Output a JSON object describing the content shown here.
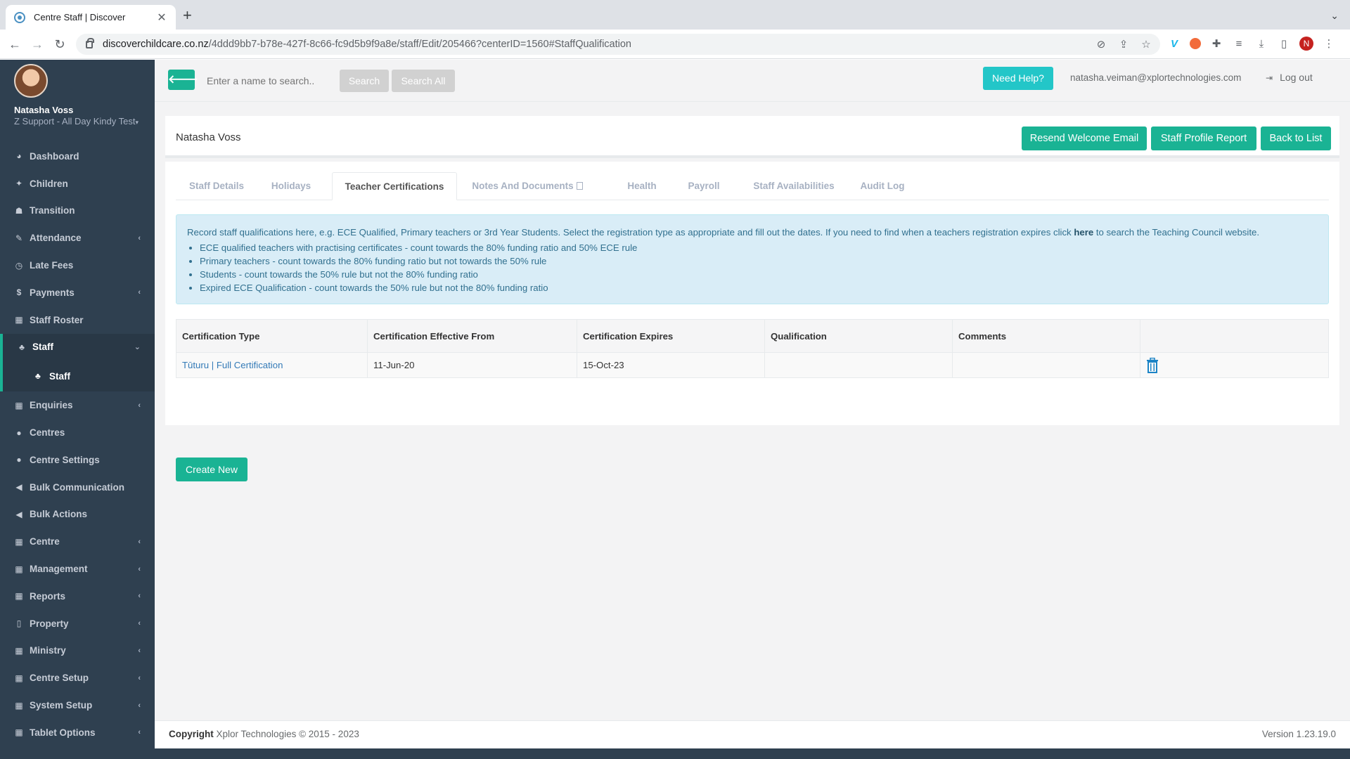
{
  "browser": {
    "tab_title": "Centre Staff | Discover",
    "tab_close": "✕",
    "new_tab": "+",
    "url_host": "discoverchildcare.co.nz",
    "url_path": "/4ddd9bb7-b78e-427f-8c66-fc9d5b9f9a8e/staff/Edit/205466?centerID=1560#StaffQualification",
    "profile_initial": "N"
  },
  "sidebar": {
    "user_name": "Natasha Voss",
    "user_role": "Z Support - All Day Kindy Test",
    "items": [
      {
        "label": "Dashboard",
        "icon": "dashboard-icon",
        "glyph": "◕",
        "chevron": ""
      },
      {
        "label": "Children",
        "icon": "child-icon",
        "glyph": "✦",
        "chevron": ""
      },
      {
        "label": "Transition",
        "icon": "graduation-icon",
        "glyph": "☗",
        "chevron": ""
      },
      {
        "label": "Attendance",
        "icon": "edit-icon",
        "glyph": "✎",
        "chevron": "‹"
      },
      {
        "label": "Late Fees",
        "icon": "clock-icon",
        "glyph": "◷",
        "chevron": ""
      },
      {
        "label": "Payments",
        "icon": "dollar-icon",
        "glyph": "$",
        "chevron": "‹"
      },
      {
        "label": "Staff Roster",
        "icon": "calendar-icon",
        "glyph": "▦",
        "chevron": ""
      },
      {
        "label": "Staff",
        "icon": "sitemap-icon",
        "glyph": "♣",
        "chevron": "⌄"
      },
      {
        "label": "Enquiries",
        "icon": "grid-icon",
        "glyph": "▦",
        "chevron": "‹"
      },
      {
        "label": "Centres",
        "icon": "circle-icon",
        "glyph": "●",
        "chevron": ""
      },
      {
        "label": "Centre Settings",
        "icon": "circle-icon",
        "glyph": "●",
        "chevron": ""
      },
      {
        "label": "Bulk Communication",
        "icon": "bullhorn-icon",
        "glyph": "◀",
        "chevron": ""
      },
      {
        "label": "Bulk Actions",
        "icon": "bullhorn-icon",
        "glyph": "◀",
        "chevron": ""
      },
      {
        "label": "Centre",
        "icon": "grid-icon",
        "glyph": "▦",
        "chevron": "‹"
      },
      {
        "label": "Management",
        "icon": "grid-icon",
        "glyph": "▦",
        "chevron": "‹"
      },
      {
        "label": "Reports",
        "icon": "grid-icon",
        "glyph": "▦",
        "chevron": "‹"
      },
      {
        "label": "Property",
        "icon": "building-icon",
        "glyph": "▯",
        "chevron": "‹"
      },
      {
        "label": "Ministry",
        "icon": "grid-icon",
        "glyph": "▦",
        "chevron": "‹"
      },
      {
        "label": "Centre Setup",
        "icon": "grid-icon",
        "glyph": "▦",
        "chevron": "‹"
      },
      {
        "label": "System Setup",
        "icon": "grid-icon",
        "glyph": "▦",
        "chevron": "‹"
      },
      {
        "label": "Tablet Options",
        "icon": "grid-icon",
        "glyph": "▦",
        "chevron": "‹"
      }
    ],
    "sub_item": "Staff"
  },
  "topbar": {
    "search_placeholder": "Enter a name to search..",
    "search_label": "Search",
    "search_all_label": "Search All",
    "help_label": "Need Help?",
    "user_email": "natasha.veiman@xplortechnologies.com",
    "logout_label": "Log out"
  },
  "header": {
    "title": "Natasha Voss",
    "resend_label": "Resend Welcome Email",
    "profile_report_label": "Staff Profile Report",
    "back_label": "Back to List"
  },
  "tabs": [
    {
      "label": "Staff Details"
    },
    {
      "label": "Holidays"
    },
    {
      "label": "Teacher Certifications"
    },
    {
      "label": "Notes And Documents"
    },
    {
      "label": "Health"
    },
    {
      "label": "Payroll"
    },
    {
      "label": "Staff Availabilities"
    },
    {
      "label": "Audit Log"
    }
  ],
  "info": {
    "text_before": "Record staff qualifications here, e.g. ECE Qualified, Primary teachers or 3rd Year Students. Select the registration type as appropriate and fill out the dates. If you need to find when a teachers registration expires click ",
    "link": "here",
    "text_after": " to search the Teaching Council website.",
    "bullets": [
      "ECE qualified teachers with practising certificates - count towards the 80% funding ratio and 50% ECE rule",
      "Primary teachers - count towards the 80% funding ratio but not towards the 50% rule",
      "Students - count towards the 50% rule but not the 80% funding ratio",
      "Expired ECE Qualification - count towards the 50% rule but not the 80% funding ratio"
    ]
  },
  "table": {
    "headers": [
      "Certification Type",
      "Certification Effective From",
      "Certification Expires",
      "Qualification",
      "Comments",
      ""
    ],
    "rows": [
      {
        "type": "Tūturu | Full Certification",
        "from": "11-Jun-20",
        "expires": "15-Oct-23",
        "qualification": "",
        "comments": ""
      }
    ]
  },
  "create_label": "Create New",
  "footer": {
    "copyright_bold": "Copyright",
    "copyright_text": " Xplor Technologies © 2015 - 2023",
    "version": "Version 1.23.19.0"
  },
  "colors": {
    "primary": "#1ab394",
    "info": "#23c6c8",
    "sidebar": "#2f4050",
    "trash": "#1c84c6"
  }
}
